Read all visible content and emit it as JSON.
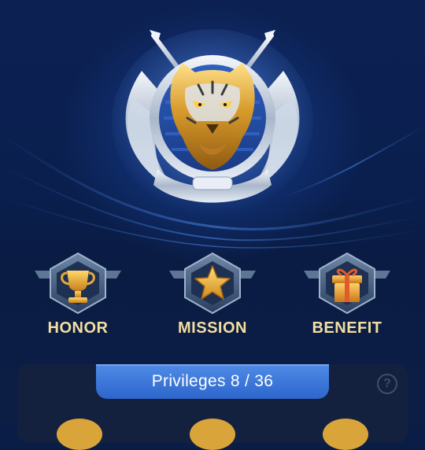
{
  "features": [
    {
      "label": "HONOR",
      "icon": "trophy-icon"
    },
    {
      "label": "MISSION",
      "icon": "star-icon"
    },
    {
      "label": "BENEFIT",
      "icon": "gift-icon"
    }
  ],
  "privileges": {
    "label": "Privileges 8 / 36",
    "help_icon": "help-icon"
  },
  "emblem": {
    "icon": "tiger-emblem-icon"
  },
  "colors": {
    "label_gold": "#f3dfa1",
    "tab_blue": "#3b74d8",
    "panel": "#13213f",
    "background": "#0a1d47"
  }
}
